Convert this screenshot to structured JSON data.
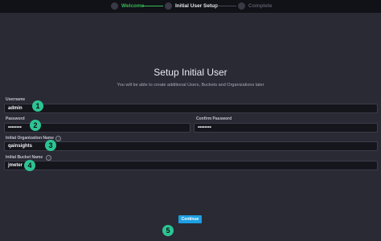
{
  "steps": [
    {
      "label": "Welcome",
      "state": "done"
    },
    {
      "label": "Initial User Setup",
      "state": "active"
    },
    {
      "label": "Complete",
      "state": "todo"
    }
  ],
  "form": {
    "title": "Setup Initial User",
    "subtitle": "You will be able to create additional Users, Buckets and Organizations later",
    "username": {
      "label": "Username",
      "value": "admin"
    },
    "password": {
      "label": "Password",
      "value": "••••••••"
    },
    "confirm_password": {
      "label": "Confirm Password",
      "value": "••••••••"
    },
    "organization": {
      "label": "Initial Organization Name",
      "value": "qainsights",
      "help_icon": "?"
    },
    "bucket": {
      "label": "Initial Bucket Name",
      "value": "jmeter",
      "help_icon": "?"
    },
    "continue_label": "Continue"
  },
  "annotations": [
    "1",
    "2",
    "3",
    "4",
    "5"
  ],
  "colors": {
    "done": "#34bb55",
    "badge": "#2cc493",
    "button": "#1d9fe3"
  }
}
